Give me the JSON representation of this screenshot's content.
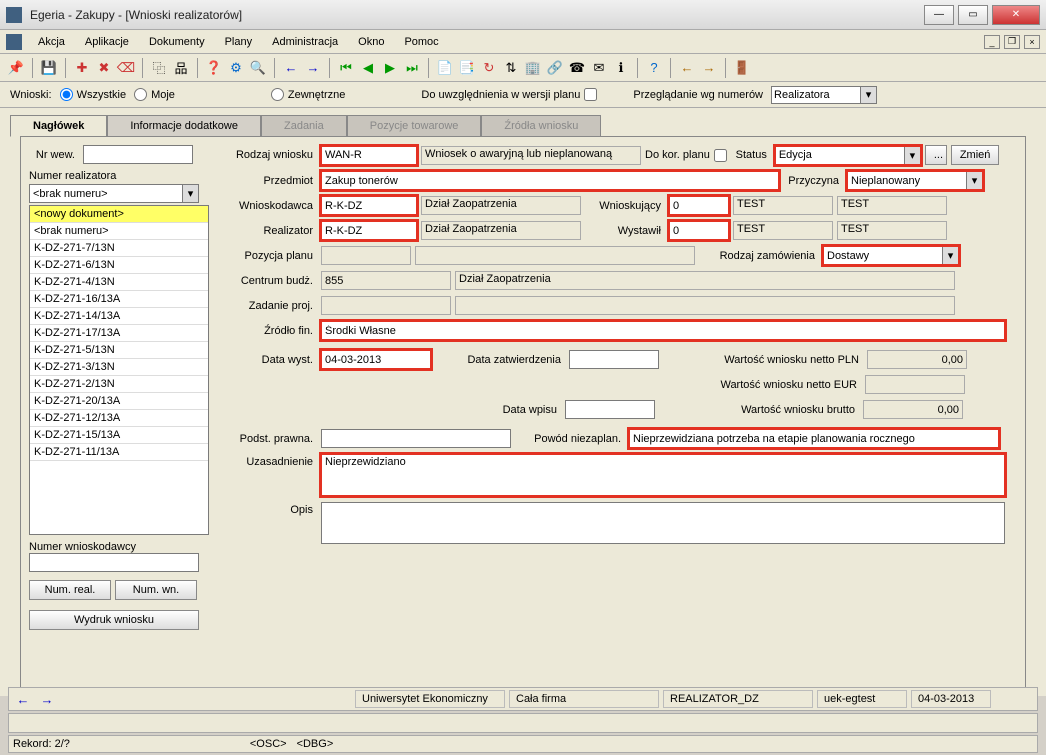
{
  "window": {
    "title": "Egeria - Zakupy - [Wnioski realizatorów]"
  },
  "menu": {
    "akcja": "Akcja",
    "aplikacje": "Aplikacje",
    "dokumenty": "Dokumenty",
    "plany": "Plany",
    "administracja": "Administracja",
    "okno": "Okno",
    "pomoc": "Pomoc"
  },
  "filters": {
    "wnioski_label": "Wnioski:",
    "wszystkie": "Wszystkie",
    "moje": "Moje",
    "zewnetrzne": "Zewnętrzne",
    "do_uwz": "Do uwzględnienia w wersji planu",
    "przegladanie": "Przeglądanie wg numerów",
    "przegladanie_val": "Realizatora"
  },
  "tabs": {
    "naglowek": "Nagłówek",
    "info": "Informacje dodatkowe",
    "zadania": "Zadania",
    "pozycje": "Pozycje towarowe",
    "zrodla": "Źródła wniosku"
  },
  "left": {
    "nr_wew_label": "Nr wew.",
    "numer_real_label": "Numer realizatora",
    "list_top": "<brak numeru>",
    "items": [
      "<nowy dokument>",
      "<brak numeru>",
      "K-DZ-271-7/13N",
      "K-DZ-271-6/13N",
      "K-DZ-271-4/13N",
      "K-DZ-271-16/13A",
      "K-DZ-271-14/13A",
      "K-DZ-271-17/13A",
      "K-DZ-271-5/13N",
      "K-DZ-271-3/13N",
      "K-DZ-271-2/13N",
      "K-DZ-271-20/13A",
      "K-DZ-271-12/13A",
      "K-DZ-271-15/13A",
      "K-DZ-271-11/13A"
    ],
    "numer_wn_label": "Numer wnioskodawcy",
    "btn_numreal": "Num. real.",
    "btn_numwn": "Num. wn.",
    "btn_wydruk": "Wydruk wniosku"
  },
  "form": {
    "rodzaj_wniosku_label": "Rodzaj wniosku",
    "rodzaj_wniosku": "WAN-R",
    "rodzaj_desc": "Wniosek o awaryjną lub nieplanowaną",
    "do_kor": "Do kor. planu",
    "status_label": "Status",
    "status": "Edycja",
    "zmien": "Zmień",
    "ellipsis": "...",
    "przedmiot_label": "Przedmiot",
    "przedmiot": "Zakup tonerów",
    "przyczyna_label": "Przyczyna",
    "przyczyna": "Nieplanowany",
    "wnioskodawca_label": "Wnioskodawca",
    "wnioskodawca": "R-K-DZ",
    "dzial": "Dział Zaopatrzenia",
    "wnioskujacy_label": "Wnioskujący",
    "wnioskujacy": "0",
    "test": "TEST",
    "realizator_label": "Realizator",
    "realizator": "R-K-DZ",
    "wystawil_label": "Wystawił",
    "wystawil": "0",
    "pozycja_planu_label": "Pozycja planu",
    "rodzaj_zam_label": "Rodzaj zamówienia",
    "rodzaj_zam": "Dostawy",
    "centrum_label": "Centrum budż.",
    "centrum": "855",
    "zadanie_label": "Zadanie proj.",
    "zrodlo_label": "Źródło fin.",
    "zrodlo": "Środki Własne",
    "data_wyst_label": "Data wyst.",
    "data_wyst": "04-03-2013",
    "data_zatw_label": "Data zatwierdzenia",
    "wart_netto_pln_label": "Wartość wniosku netto PLN",
    "wart_netto_pln": "0,00",
    "wart_netto_eur_label": "Wartość wniosku netto EUR",
    "data_wpisu_label": "Data wpisu",
    "wart_brutto_label": "Wartość wniosku brutto",
    "wart_brutto": "0,00",
    "podst_label": "Podst. prawna.",
    "powod_label": "Powód niezaplan.",
    "powod": "Nieprzewidziana potrzeba na etapie planowania rocznego",
    "uzasadnienie_label": "Uzasadnienie",
    "uzasadnienie": "Nieprzewidziano",
    "opis_label": "Opis"
  },
  "status": {
    "org": "Uniwersytet Ekonomiczny",
    "firma": "Cała firma",
    "user": "REALIZATOR_DZ",
    "db": "uek-egtest",
    "date": "04-03-2013",
    "rekord": "Rekord: 2/?",
    "osc": "<OSC>",
    "dbg": "<DBG>"
  }
}
